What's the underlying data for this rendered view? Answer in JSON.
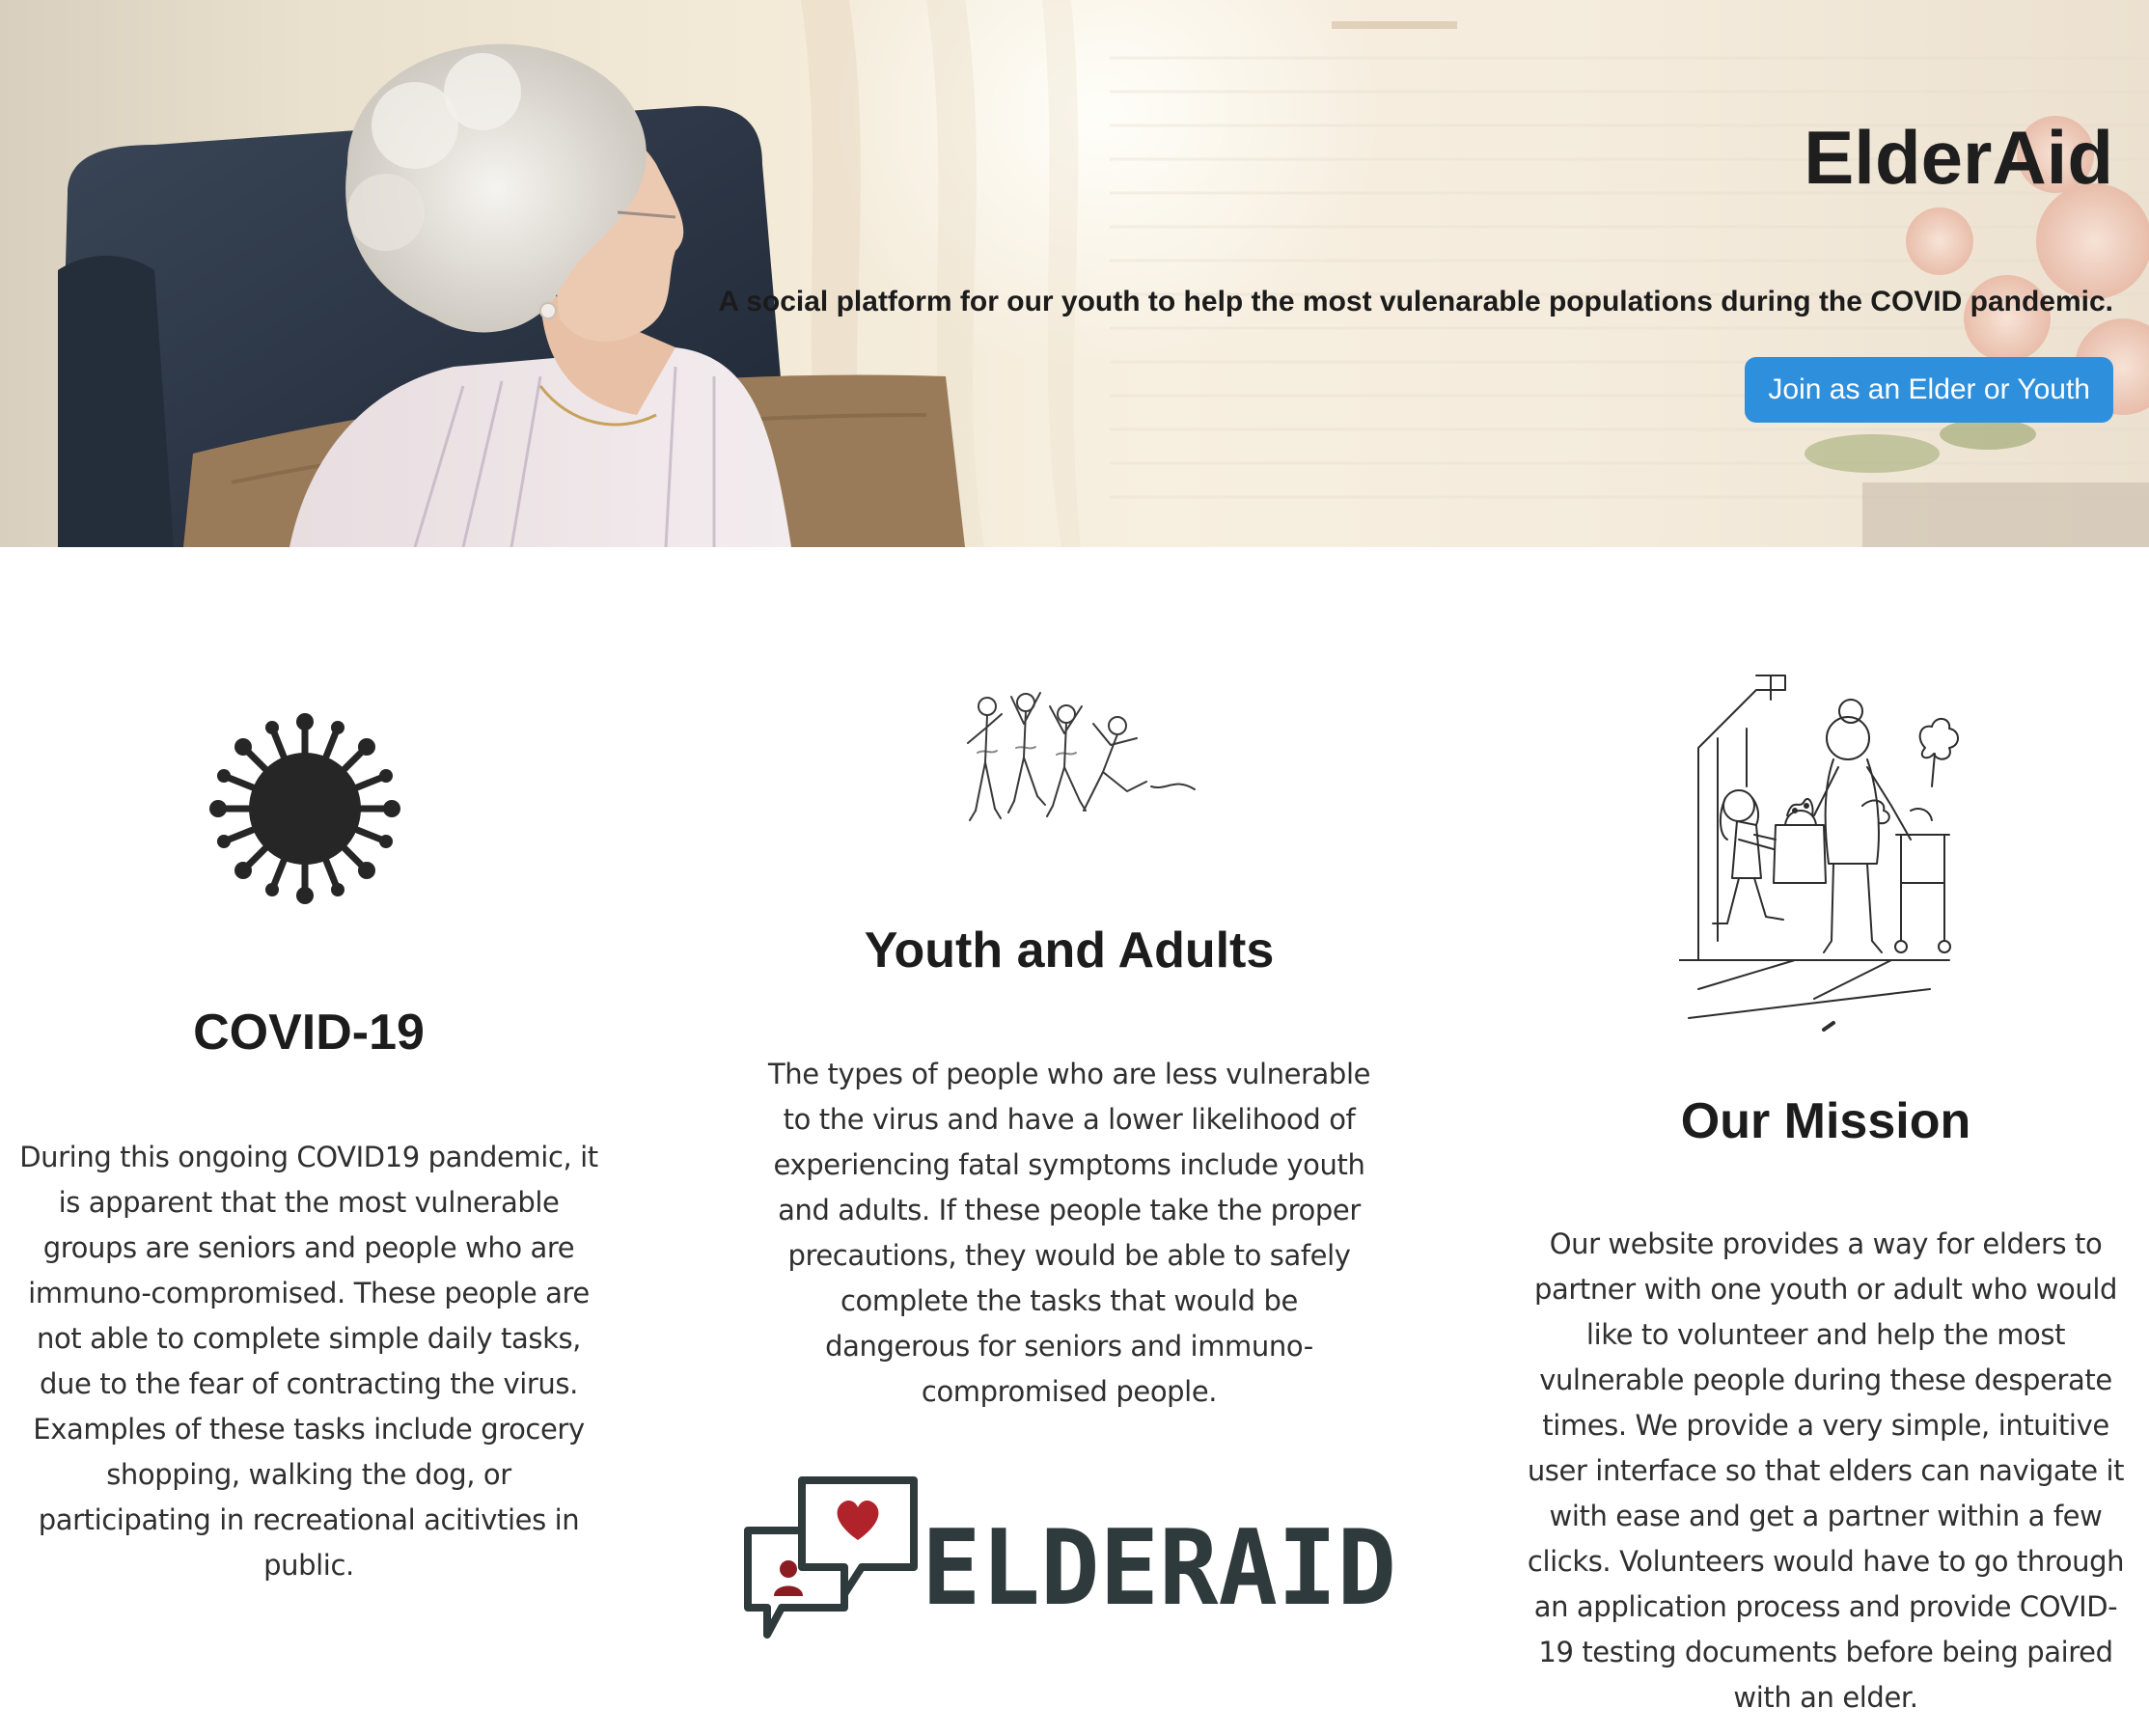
{
  "hero": {
    "title": "ElderAid",
    "subtitle": "A social platform for our youth to help the most vulenarable populations during the COVID pandemic.",
    "cta_label": "Join as an Elder or Youth"
  },
  "features": [
    {
      "icon": "virus-icon",
      "title": "COVID-19",
      "text": "During this ongoing COVID19 pandemic, it is apparent that the most vulnerable groups are seniors and people who are immuno-compromised. These people are not able to complete simple daily tasks, due to the fear of contracting the virus. Examples of these tasks include grocery shopping, walking the dog, or participating in recreational acitivties in public."
    },
    {
      "icon": "jumping-people-illustration",
      "title": "Youth and Adults",
      "text": "The types of people who are less vulnerable to the virus and have a lower likelihood of experiencing fatal symptoms include youth and adults. If these people take the proper precautions, they would be able to safely complete the tasks that would be dangerous for seniors and immuno-compromised people."
    },
    {
      "icon": "girl-helping-elder-illustration",
      "title": "Our Mission",
      "text": "Our website provides a way for elders to partner with one youth or adult who would like to volunteer and help the most vulnerable people during these desperate times. We provide a very simple, intuitive user interface so that elders can navigate it with ease and get a partner within a few clicks. Volunteers would have to go through an application process and provide COVID-19 testing documents before being paired with an elder."
    }
  ],
  "logo": {
    "text": "ELDERAID",
    "icon": "chat-bubbles-heart-logo"
  },
  "colors": {
    "button": "#2e8fdc",
    "logo_text": "#2f3a3c",
    "heart": "#b0232a",
    "heading": "#1c1c1c"
  }
}
